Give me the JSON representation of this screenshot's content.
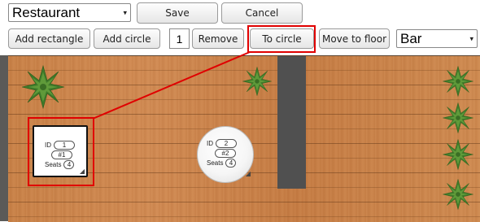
{
  "toolbar": {
    "floor_select": {
      "value": "Restaurant"
    },
    "save_label": "Save",
    "cancel_label": "Cancel",
    "add_rectangle_label": "Add rectangle",
    "add_circle_label": "Add circle",
    "selected_id": "1",
    "remove_label": "Remove",
    "to_circle_label": "To circle",
    "move_to_floor_label": "Move to floor",
    "target_floor_select": {
      "value": "Bar"
    }
  },
  "tables": [
    {
      "shape": "rectangle",
      "id_label": "ID",
      "id": "1",
      "name": "#1",
      "seats_label": "Seats",
      "seats": "4",
      "selected": true
    },
    {
      "shape": "circle",
      "id_label": "ID",
      "id": "2",
      "name": "#2",
      "seats_label": "Seats",
      "seats": "4",
      "selected": false
    }
  ],
  "plants": [
    "plant-icon",
    "plant-icon",
    "plant-icon",
    "plant-icon",
    "plant-icon",
    "plant-icon",
    "plant-icon"
  ],
  "colors": {
    "highlight": "#e00000",
    "wall": "#505050",
    "wood": "#c98147"
  },
  "icons": {
    "select_caret": "▾",
    "resize_handle": "◢"
  }
}
